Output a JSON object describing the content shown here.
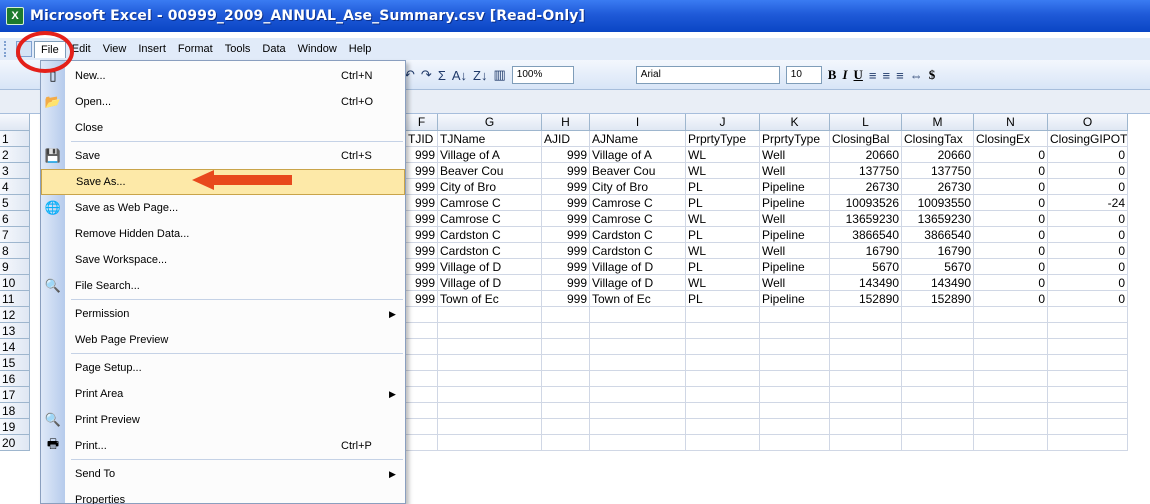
{
  "window": {
    "title": "Microsoft Excel - 00999_2009_ANNUAL_Ase_Summary.csv  [Read-Only]",
    "app_icon": "X"
  },
  "menubar": {
    "items": [
      {
        "label": "File",
        "active": true
      },
      {
        "label": "Edit"
      },
      {
        "label": "View"
      },
      {
        "label": "Insert"
      },
      {
        "label": "Format"
      },
      {
        "label": "Tools"
      },
      {
        "label": "Data"
      },
      {
        "label": "Window"
      },
      {
        "label": "Help"
      }
    ]
  },
  "toolbar": {
    "undo": "↶",
    "redo": "↷",
    "sum": "Σ",
    "sort_asc": "A↓",
    "sort_desc": "Z↓",
    "chart": "▥",
    "zoom": "100%",
    "font": "Arial",
    "font_size": "10",
    "bold": "B",
    "italic": "I",
    "underline": "U",
    "align_left": "≡",
    "center": "≡",
    "align_right": "≡",
    "merge": "⇔",
    "currency": "$"
  },
  "file_menu": {
    "items": [
      {
        "label": "New...",
        "shortcut": "Ctrl+N",
        "icon": "new-icon",
        "glyph": "▯"
      },
      {
        "label": "Open...",
        "shortcut": "Ctrl+O",
        "icon": "open-icon",
        "glyph": "📂"
      },
      {
        "label": "Close",
        "shortcut": "",
        "icon": "",
        "glyph": ""
      },
      {
        "label": "Save",
        "shortcut": "Ctrl+S",
        "icon": "save-icon",
        "glyph": "💾"
      },
      {
        "label": "Save As...",
        "shortcut": "",
        "icon": "",
        "glyph": "",
        "highlighted": true
      },
      {
        "label": "Save as Web Page...",
        "shortcut": "",
        "icon": "web-page-icon",
        "glyph": "🌐"
      },
      {
        "label": "Remove Hidden Data...",
        "shortcut": "",
        "icon": "",
        "glyph": ""
      },
      {
        "label": "Save Workspace...",
        "shortcut": "",
        "icon": "",
        "glyph": ""
      },
      {
        "label": "File Search...",
        "shortcut": "",
        "icon": "file-search-icon",
        "glyph": "🔍"
      },
      {
        "label": "Permission",
        "shortcut": "",
        "icon": "",
        "glyph": "",
        "submenu": true
      },
      {
        "label": "Web Page Preview",
        "shortcut": "",
        "icon": "",
        "glyph": ""
      },
      {
        "label": "Page Setup...",
        "shortcut": "",
        "icon": "",
        "glyph": ""
      },
      {
        "label": "Print Area",
        "shortcut": "",
        "icon": "",
        "glyph": "",
        "submenu": true
      },
      {
        "label": "Print Preview",
        "shortcut": "",
        "icon": "print-preview-icon",
        "glyph": "🔍"
      },
      {
        "label": "Print...",
        "shortcut": "Ctrl+P",
        "icon": "print-icon",
        "glyph": "🖶"
      },
      {
        "label": "Send To",
        "shortcut": "",
        "icon": "",
        "glyph": "",
        "submenu": true
      },
      {
        "label": "Properties",
        "shortcut": "",
        "icon": "",
        "glyph": ""
      }
    ],
    "submenu_arrow": "▶"
  },
  "sheet": {
    "columns": [
      "F",
      "G",
      "H",
      "I",
      "J",
      "K",
      "L",
      "M",
      "N",
      "O"
    ],
    "row_numbers": [
      "1",
      "2",
      "3",
      "4",
      "5",
      "6",
      "7",
      "8",
      "9",
      "10",
      "11",
      "12",
      "13",
      "14",
      "15",
      "16",
      "17",
      "18",
      "19",
      "20"
    ],
    "header_row": [
      "TJID",
      "TJName",
      "AJID",
      "AJName",
      "PrprtyType",
      "PrprtyType",
      "ClosingBal",
      "ClosingTax",
      "ClosingEx",
      "ClosingGIPOT"
    ],
    "rows": [
      [
        "999",
        "Village of A",
        "999",
        "Village of A",
        "WL",
        "Well",
        "20660",
        "20660",
        "0",
        "0"
      ],
      [
        "999",
        "Beaver Cou",
        "999",
        "Beaver Cou",
        "WL",
        "Well",
        "137750",
        "137750",
        "0",
        "0"
      ],
      [
        "999",
        "City of Bro",
        "999",
        "City of Bro",
        "PL",
        "Pipeline",
        "26730",
        "26730",
        "0",
        "0"
      ],
      [
        "999",
        "Camrose C",
        "999",
        "Camrose C",
        "PL",
        "Pipeline",
        "10093526",
        "10093550",
        "0",
        "-24"
      ],
      [
        "999",
        "Camrose C",
        "999",
        "Camrose C",
        "WL",
        "Well",
        "13659230",
        "13659230",
        "0",
        "0"
      ],
      [
        "999",
        "Cardston C",
        "999",
        "Cardston C",
        "PL",
        "Pipeline",
        "3866540",
        "3866540",
        "0",
        "0"
      ],
      [
        "999",
        "Cardston C",
        "999",
        "Cardston C",
        "WL",
        "Well",
        "16790",
        "16790",
        "0",
        "0"
      ],
      [
        "999",
        "Village of D",
        "999",
        "Village of D",
        "PL",
        "Pipeline",
        "5670",
        "5670",
        "0",
        "0"
      ],
      [
        "999",
        "Village of D",
        "999",
        "Village of D",
        "WL",
        "Well",
        "143490",
        "143490",
        "0",
        "0"
      ],
      [
        "999",
        "Town of Ec",
        "999",
        "Town of Ec",
        "PL",
        "Pipeline",
        "152890",
        "152890",
        "0",
        "0"
      ]
    ]
  },
  "annotations": {
    "circle_color": "#e4201a",
    "arrow_color": "#e8491d"
  }
}
